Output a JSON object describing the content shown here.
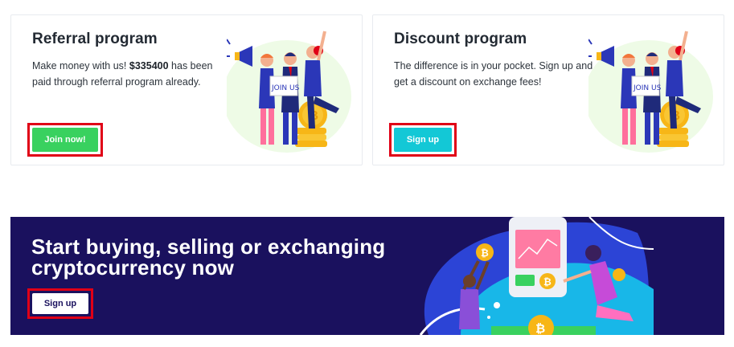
{
  "referral": {
    "title": "Referral program",
    "text_before": "Make money with us! ",
    "amount": "$335400",
    "text_after": " has been paid through referral program already.",
    "button_label": "Join now!",
    "illustration_sign": "JOIN US"
  },
  "discount": {
    "title": "Discount program",
    "text": "The difference is in your pocket. Sign up and get a discount on exchange fees!",
    "button_label": "Sign up",
    "illustration_sign": "JOIN US"
  },
  "banner": {
    "title": "Start buying, selling or exchanging cryptocurrency now",
    "button_label": "Sign up",
    "coin_symbol": "₿"
  },
  "colors": {
    "green_button": "#39d15f",
    "teal_button": "#13c8d6",
    "banner_bg": "#1a115e",
    "highlight_border": "#e00016"
  }
}
